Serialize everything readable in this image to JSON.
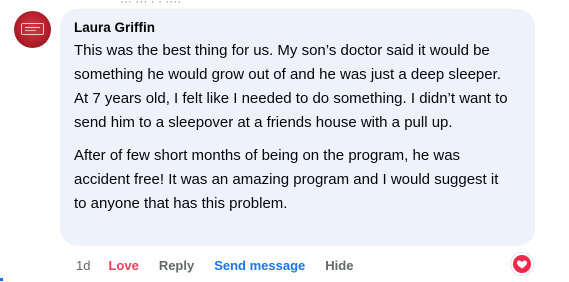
{
  "comment": {
    "author": "Laura Griffin",
    "paragraphs": [
      "This was the best thing for us. My son’s doctor said it would be something he would grow out of and he was just a deep sleeper. At 7 years old, I felt like I needed to do something. I didn’t want to send him to a sleepover at a friends house with a pull up.",
      "After of few short months of being on the program, he was accident free! It was an amazing program and I would suggest it to anyone that has this problem."
    ],
    "time": "1d",
    "reaction_label": "Love",
    "reply_label": "Reply",
    "send_message_label": "Send message",
    "hide_label": "Hide",
    "reaction_icon": "love-heart-icon"
  },
  "colors": {
    "bubble_bg": "#eef3fb",
    "love": "#e4415a",
    "link_blue": "#1b74e4",
    "meta_gray": "#65676b",
    "avatar_red": "#b2202b"
  }
}
